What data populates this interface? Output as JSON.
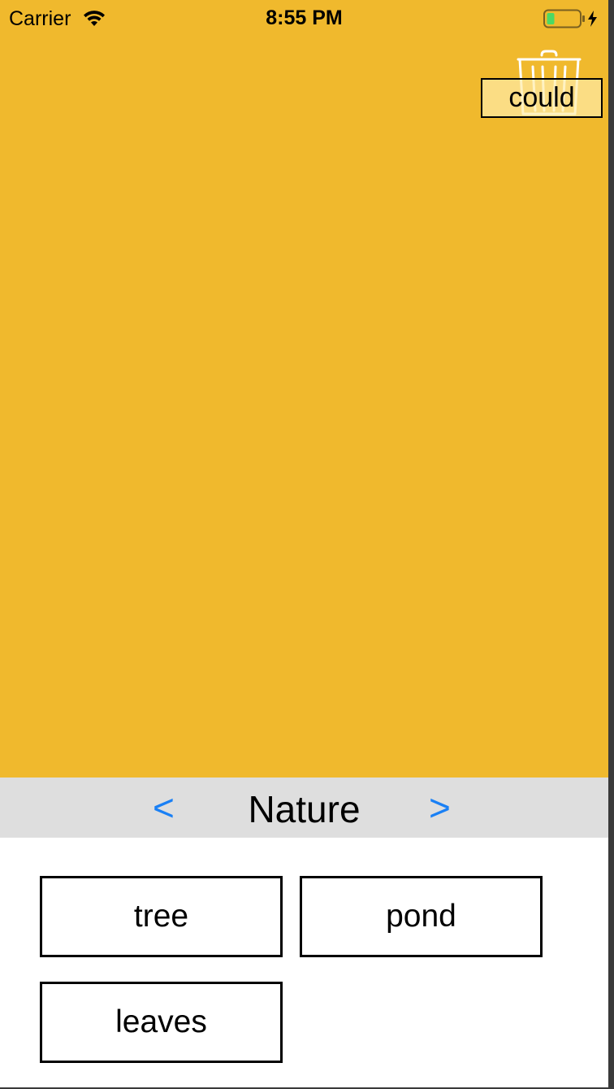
{
  "status_bar": {
    "carrier": "Carrier",
    "time": "8:55 PM"
  },
  "canvas": {
    "background_color": "#f0b92d",
    "dragged_word": "could"
  },
  "category": {
    "prev_label": "<",
    "title": "Nature",
    "next_label": ">",
    "nav_color": "#1a80f5"
  },
  "words": [
    {
      "label": "tree"
    },
    {
      "label": "pond"
    },
    {
      "label": "leaves"
    }
  ],
  "icons": {
    "wifi": "wifi-icon",
    "battery": "battery-icon",
    "trash": "trash-icon"
  }
}
